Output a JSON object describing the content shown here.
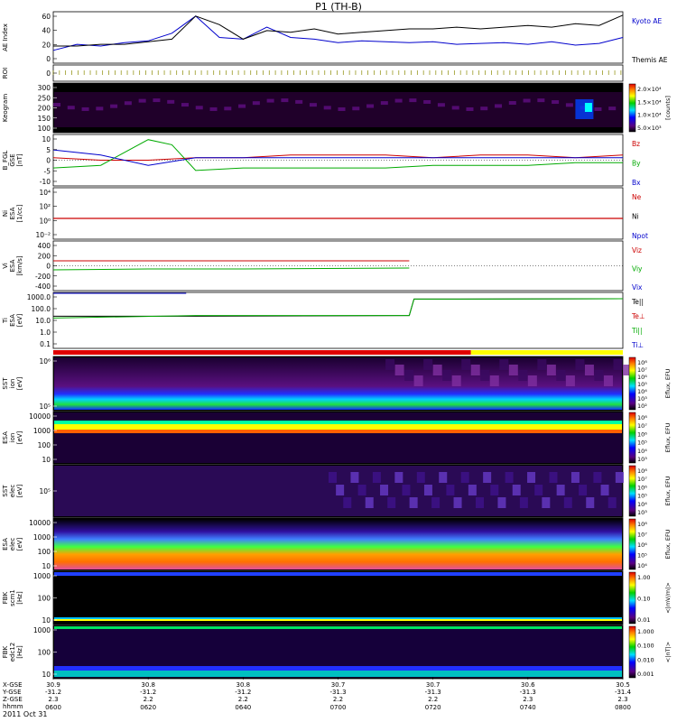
{
  "title": "P1 (TH-B)",
  "footer_date": "2011 Oct 31",
  "time_ticks": [
    "0600",
    "0620",
    "0640",
    "0700",
    "0720",
    "0740",
    "0800"
  ],
  "ephem_labels": [
    "X-GSE",
    "Y-GSE",
    "Z-GSE",
    "hhmm"
  ],
  "ephem_values": [
    [
      "30.9",
      "-31.2",
      "2.3"
    ],
    [
      "30.8",
      "-31.2",
      "2.2"
    ],
    [
      "30.8",
      "-31.2",
      "2.2"
    ],
    [
      "30.7",
      "-31.3",
      "2.2"
    ],
    [
      "30.7",
      "-31.3",
      "2.2"
    ],
    [
      "30.6",
      "-31.3",
      "2.3"
    ],
    [
      "30.5",
      "-31.4",
      "2.3"
    ]
  ],
  "panels": {
    "ae": {
      "ylabel": "AE Index",
      "ticks": [
        "60",
        "40",
        "20",
        "0"
      ],
      "legend": [
        {
          "name": "Kyoto AE",
          "color": "#0000cc"
        },
        {
          "name": "Themis AE",
          "color": "#000000"
        }
      ]
    },
    "roi": {
      "ylabel": "ROI",
      "ticks": [
        "0"
      ]
    },
    "keogram": {
      "ylabel": "Keogram",
      "ticks": [
        "300",
        "250",
        "200",
        "150",
        "100"
      ],
      "colorbar_ticks": [
        "2.0×10⁴",
        "1.5×10⁴",
        "1.0×10⁴",
        "5.0×10³"
      ],
      "colorbar_label": "[counts]"
    },
    "bfgl": {
      "ylabel": "B_FGL",
      "units": "[nT]",
      "sub": "GSE",
      "ticks": [
        "10",
        "5",
        "0",
        "-5",
        "-10"
      ],
      "legend": [
        {
          "name": "Bz",
          "color": "#cc0000"
        },
        {
          "name": "By",
          "color": "#00aa00"
        },
        {
          "name": "Bx",
          "color": "#0000cc"
        }
      ]
    },
    "ni": {
      "ylabel": "Ni",
      "units": "[1/cc]",
      "sub": "ESA",
      "ticks": [
        "10⁴",
        "10²",
        "10⁰",
        "10⁻²"
      ],
      "legend": [
        {
          "name": "Ne",
          "color": "#cc0000"
        },
        {
          "name": "Ni",
          "color": "#000000"
        },
        {
          "name": "Npot",
          "color": "#0000cc"
        }
      ]
    },
    "vi": {
      "ylabel": "Vi",
      "units": "[km/s]",
      "sub": "ESA",
      "ticks": [
        "400",
        "200",
        "0",
        "-200",
        "-400"
      ],
      "legend": [
        {
          "name": "Viz",
          "color": "#cc0000"
        },
        {
          "name": "Viy",
          "color": "#00aa00"
        },
        {
          "name": "Vix",
          "color": "#0000cc"
        }
      ]
    },
    "ti": {
      "ylabel": "Ti",
      "units": "[eV]",
      "sub": "ESA",
      "ticks": [
        "1000.0",
        "100.0",
        "10.0",
        "1.0",
        "0.1"
      ],
      "legend": [
        {
          "name": "Te||",
          "color": "#000000"
        },
        {
          "name": "Te⊥",
          "color": "#cc0000"
        },
        {
          "name": "Ti||",
          "color": "#00aa00"
        },
        {
          "name": "Ti⊥",
          "color": "#0000cc"
        }
      ]
    },
    "sst_i": {
      "ylabel": "SST",
      "sub": "ion",
      "units": "[eV]",
      "ticks": [
        "10⁶",
        "10⁵"
      ],
      "colorbar_ticks": [
        "10⁸",
        "10⁷",
        "10⁶",
        "10⁵",
        "10⁴",
        "10³",
        "10²"
      ],
      "colorbar_label": "Eflux, EFU"
    },
    "esa_i": {
      "ylabel": "ESA",
      "sub": "ion",
      "units": "[eV]",
      "ticks": [
        "10000",
        "1000",
        "100",
        "10"
      ],
      "colorbar_ticks": [
        "10⁸",
        "10⁷",
        "10⁶",
        "10⁵",
        "10⁴",
        "10³"
      ],
      "colorbar_label": "Eflux, EFU"
    },
    "sst_e": {
      "ylabel": "SST",
      "sub": "elec",
      "units": "[eV]",
      "ticks": [
        "10⁵"
      ],
      "colorbar_ticks": [
        "10⁸",
        "10⁷",
        "10⁶",
        "10⁵",
        "10⁴",
        "10³"
      ],
      "colorbar_label": "Eflux, EFU"
    },
    "esa_e": {
      "ylabel": "ESA",
      "sub": "elec",
      "units": "[eV]",
      "ticks": [
        "10000",
        "1000",
        "100",
        "10"
      ],
      "colorbar_ticks": [
        "10⁸",
        "10⁷",
        "10⁶",
        "10⁵",
        "10⁴"
      ],
      "colorbar_label": "Eflux, EFU"
    },
    "fbk_b": {
      "ylabel": "FBK",
      "sub": "scm1",
      "units": "[Hz]",
      "ticks": [
        "1000",
        "100",
        "10"
      ],
      "colorbar_ticks": [
        "1.00",
        "0.10",
        "0.01"
      ],
      "colorbar_label": "<|mV/m|>"
    },
    "fbk_e": {
      "ylabel": "FBK",
      "sub": "edc12",
      "units": "[Hz]",
      "ticks": [
        "1000",
        "100",
        "10"
      ],
      "colorbar_ticks": [
        "1.000",
        "0.100",
        "0.010",
        "0.001"
      ],
      "colorbar_label": "<|nT|>"
    }
  },
  "chart_data": {
    "type": "line",
    "x_unit": "hhmm",
    "x_range": [
      "0600",
      "0800"
    ],
    "ae": {
      "ylim": [
        0,
        60
      ],
      "series": [
        {
          "name": "Kyoto AE",
          "color": "#0000cc",
          "x": [
            0,
            5,
            10,
            15,
            20,
            25,
            30,
            35,
            40,
            45,
            50,
            55,
            60,
            65,
            70,
            75,
            80,
            85,
            90,
            95,
            100,
            105,
            110,
            115,
            120
          ],
          "values": [
            15,
            22,
            20,
            24,
            26,
            35,
            55,
            30,
            28,
            42,
            30,
            28,
            24,
            26,
            25,
            24,
            25,
            22,
            23,
            24,
            22,
            25,
            21,
            23,
            30
          ]
        },
        {
          "name": "Themis AE",
          "color": "#000000",
          "x": [
            0,
            5,
            10,
            15,
            20,
            25,
            30,
            35,
            40,
            45,
            50,
            55,
            60,
            65,
            70,
            75,
            80,
            85,
            90,
            95,
            100,
            105,
            110,
            115,
            120
          ],
          "values": [
            20,
            20,
            22,
            22,
            25,
            28,
            55,
            45,
            28,
            38,
            36,
            40,
            34,
            36,
            38,
            40,
            40,
            42,
            40,
            42,
            44,
            42,
            46,
            44,
            56
          ]
        }
      ]
    },
    "bfgl": {
      "ylim": [
        -10,
        10
      ],
      "series": [
        {
          "name": "Bz",
          "color": "#cc0000",
          "x": [
            0,
            10,
            20,
            30,
            40,
            50,
            60,
            70,
            80,
            90,
            100,
            110,
            120
          ],
          "values": [
            1,
            0,
            0,
            1,
            1,
            2,
            2,
            2,
            1,
            2,
            2,
            1,
            2
          ]
        },
        {
          "name": "By",
          "color": "#00aa00",
          "x": [
            0,
            10,
            20,
            25,
            30,
            40,
            50,
            60,
            70,
            80,
            90,
            100,
            110,
            120
          ],
          "values": [
            -3,
            -2,
            8,
            6,
            -4,
            -3,
            -3,
            -3,
            -3,
            -2,
            -2,
            -2,
            -1,
            -1
          ]
        },
        {
          "name": "Bx",
          "color": "#0000cc",
          "x": [
            0,
            10,
            20,
            30,
            40,
            50,
            60,
            70,
            80,
            90,
            100,
            110,
            120
          ],
          "values": [
            4,
            2,
            -2,
            1,
            1,
            1,
            1,
            1,
            1,
            1,
            1,
            1,
            1
          ]
        }
      ]
    },
    "ti": {
      "yscale": "log",
      "ylim": [
        0.1,
        1000
      ],
      "series": [
        {
          "name": "Te||",
          "color": "#000000",
          "x": [
            0,
            30,
            75,
            76,
            120
          ],
          "values": [
            35,
            35,
            40,
            800,
            850
          ]
        },
        {
          "name": "Ti||",
          "color": "#00aa00",
          "x": [
            0,
            30,
            75,
            76,
            120
          ],
          "values": [
            25,
            40,
            40,
            800,
            850
          ]
        },
        {
          "name": "Ti⊥",
          "color": "#0000cc",
          "x": [
            0,
            28
          ],
          "values": [
            3000,
            3000
          ]
        }
      ]
    }
  }
}
